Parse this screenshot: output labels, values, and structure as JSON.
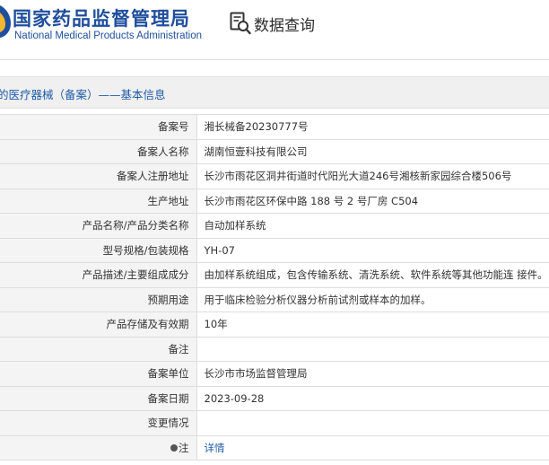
{
  "header": {
    "logo_cn": "国家药品监督管理局",
    "logo_en": "National Medical Products Administration",
    "page_title": "数据查询",
    "icons": {
      "logo": "nmpa-emblem-icon",
      "search": "data-search-icon"
    }
  },
  "breadcrumb": {
    "text": "的医疗器械（备案）——基本信息"
  },
  "record": {
    "rows": [
      {
        "label": "备案号",
        "value": "湘长械备20230777号"
      },
      {
        "label": "备案人名称",
        "value": "湖南恒壹科技有限公司"
      },
      {
        "label": "备案人注册地址",
        "value": "长沙市雨花区洞井街道时代阳光大道246号湘核新家园综合楼506号"
      },
      {
        "label": "生产地址",
        "value": "长沙市雨花区环保中路 188 号 2 号厂房 C504"
      },
      {
        "label": "产品名称/产品分类名称",
        "value": "自动加样系统"
      },
      {
        "label": "型号规格/包装规格",
        "value": "YH-07"
      },
      {
        "label": "产品描述/主要组成成分",
        "value": "由加样系统组成，包含传输系统、清洗系统、软件系统等其他功能连 接件。"
      },
      {
        "label": "预期用途",
        "value": "用于临床检验分析仪器分析前试剂或样本的加样。"
      },
      {
        "label": "产品存储及有效期",
        "value": "10年"
      },
      {
        "label": "备注",
        "value": ""
      },
      {
        "label": "备案单位",
        "value": "长沙市市场监督管理局"
      },
      {
        "label": "备案日期",
        "value": "2023-09-28"
      },
      {
        "label": "变更情况",
        "value": ""
      },
      {
        "label": "注",
        "value": "详情"
      }
    ]
  },
  "colors": {
    "brand_blue": "#1f4e9c",
    "link_blue": "#1f5aa6",
    "label_bg": "#f4f4f4",
    "border": "#dddddd"
  }
}
